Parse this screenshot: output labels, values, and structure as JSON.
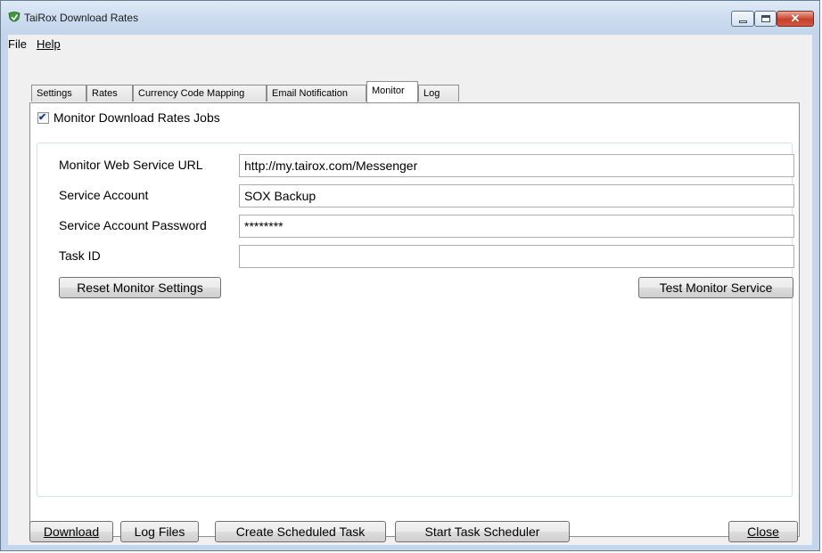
{
  "window": {
    "title": "TaiRox Download Rates",
    "close_symbol": "✕"
  },
  "menu": {
    "file": "File",
    "help": "Help"
  },
  "tabs": [
    {
      "label": "Settings"
    },
    {
      "label": "Rates"
    },
    {
      "label": "Currency Code Mapping"
    },
    {
      "label": "Email Notification"
    },
    {
      "label": "Monitor"
    },
    {
      "label": "Log"
    }
  ],
  "active_tab": "Monitor",
  "monitor": {
    "enable_checkbox": {
      "label": "Monitor Download Rates Jobs",
      "checked": true,
      "check_glyph": "✔"
    },
    "fields": {
      "url": {
        "label": "Monitor Web Service URL",
        "value": "http://my.tairox.com/Messenger"
      },
      "account": {
        "label": "Service Account",
        "value": "SOX Backup"
      },
      "password": {
        "label": "Service Account Password",
        "value": "********"
      },
      "task_id": {
        "label": "Task ID",
        "value": ""
      }
    },
    "reset_button": "Reset Monitor Settings",
    "test_button": "Test Monitor Service"
  },
  "footer": {
    "download": "Download",
    "log_files": "Log Files",
    "create_task": "Create Scheduled Task",
    "start_scheduler": "Start Task Scheduler",
    "close": "Close"
  },
  "icons": {
    "app": "shield-check-icon",
    "minimize": "minimize-icon",
    "maximize": "maximize-icon",
    "close": "close-icon"
  },
  "colors": {
    "accent": "#3c9a3c",
    "close_red": "#c7412b"
  }
}
